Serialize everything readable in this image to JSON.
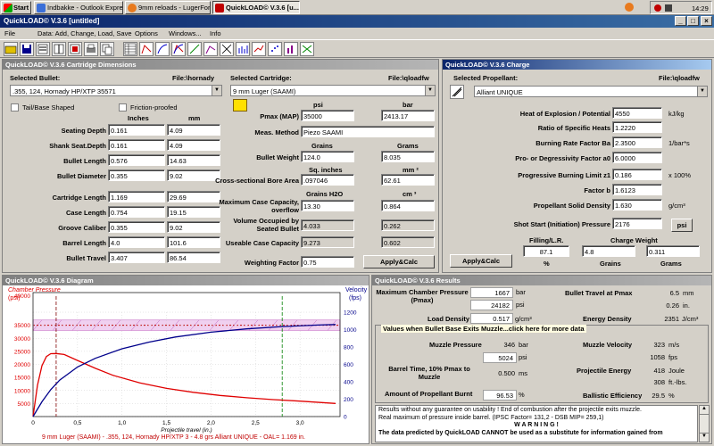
{
  "taskbar": {
    "start": "Start",
    "tasks": [
      "Indbakke - Outlook Express",
      "9mm reloads - LugerForu...",
      "QuickLOAD© V.3.6  [u..."
    ],
    "clock": "14:29"
  },
  "window": {
    "title": "QuickLOAD© V.3.6   [untitled]"
  },
  "menu": [
    "File",
    "Data: Add, Change, Load, Save",
    "Options",
    "Windows...",
    "Info"
  ],
  "cartridge_panel": {
    "title": "QuickLOAD© V.3.6 Cartridge Dimensions",
    "selected_bullet_label": "Selected Bullet:",
    "bullet_file": "File:\\hornady",
    "bullet_value": ".355, 124, Hornady HP/XTP 35571",
    "tailbase_label": "Tail/Base Shaped",
    "friction_label": "Friction-proofed",
    "unit_inches": "Inches",
    "unit_mm": "mm",
    "rows": [
      {
        "label": "Seating Depth",
        "in": "0.161",
        "mm": "4.09"
      },
      {
        "label": "Shank Seat.Depth",
        "in": "0.161",
        "mm": "4.09"
      },
      {
        "label": "Bullet Length",
        "in": "0.576",
        "mm": "14.63"
      },
      {
        "label": "Bullet Diameter",
        "in": "0.355",
        "mm": "9.02"
      },
      {
        "label": "Cartridge Length",
        "in": "1.169",
        "mm": "29.69"
      },
      {
        "label": "Case Length",
        "in": "0.754",
        "mm": "19.15"
      },
      {
        "label": "Groove Caliber",
        "in": "0.355",
        "mm": "9.02"
      },
      {
        "label": "Barrel Length",
        "in": "4.0",
        "mm": "101.6"
      },
      {
        "label": "Bullet Travel",
        "in": "3.407",
        "mm": "86.54"
      }
    ],
    "selected_cartridge_label": "Selected Cartridge:",
    "cartridge_file": "File:\\qloadfw",
    "cartridge_value": "9 mm Luger (SAAMI)",
    "psi_label": "psi",
    "bar_label": "bar",
    "pmax_label": "Pmax (MAP)",
    "pmax_psi": "35000",
    "pmax_bar": "2413.17",
    "meas_method_label": "Meas. Method",
    "meas_method": "Piezo SAAMI",
    "grains_label": "Grains",
    "grams_label": "Grams",
    "bullet_weight_label": "Bullet Weight",
    "bullet_weight_gr": "124.0",
    "bullet_weight_g": "8.035",
    "sq_inches_label": "Sq. inches",
    "mm2_label": "mm ²",
    "bore_area_label": "Cross-sectional Bore Area",
    "bore_area_in": ".097046",
    "bore_area_mm": "62.61",
    "grains_h2o_label": "Grains H2O",
    "cm3_label": "cm ³",
    "max_case_label": "Maximum Case Capacity, overflow",
    "max_case_gr": "13.30",
    "max_case_cm": "0.864",
    "vol_seated_label": "Volume Occupied by Seated Bullet",
    "vol_seated_gr": "4.033",
    "vol_seated_cm": "0.262",
    "useable_label": "Useable Case Capacity",
    "useable_gr": "9.273",
    "useable_cm": "0.602",
    "weighting_label": "Weighting Factor",
    "weighting": "0.75",
    "apply_label": "Apply&Calc"
  },
  "charge_panel": {
    "title": "QuickLOAD© V.3.6 Charge",
    "selected_propellant_label": "Selected Propellant:",
    "prop_file": "File:\\qloadfw",
    "propellant": "Alliant UNIQUE",
    "rows": [
      {
        "label": "Heat of Explosion / Potential",
        "value": "4550",
        "unit": "kJ/kg"
      },
      {
        "label": "Ratio of Specific Heats",
        "value": "1.2220",
        "unit": ""
      },
      {
        "label": "Burning Rate Factor  Ba",
        "value": "2.3500",
        "unit": "1/bar*s"
      },
      {
        "label": "Pro- or Degressivity Factor  a0",
        "value": "6.0000",
        "unit": ""
      },
      {
        "label": "Progressive Burning Limit z1",
        "value": "0.186",
        "unit": "x 100%"
      },
      {
        "label": "Factor  b",
        "value": "1.6123",
        "unit": ""
      },
      {
        "label": "Propellant Solid Density",
        "value": "1.630",
        "unit": "g/cm³"
      },
      {
        "label": "Shot Start (Initiation) Pressure",
        "value": "2176",
        "unit": ""
      }
    ],
    "psi_button": "psi",
    "filling_label": "Filling/L.R.",
    "charge_weight_label": "Charge Weight",
    "filling": "87.1",
    "charge_grains": "4.8",
    "charge_grams": "0.311",
    "pct": "%",
    "grains": "Grains",
    "grams": "Grams",
    "apply_label": "Apply&Calc"
  },
  "diagram_panel": {
    "title": "QuickLOAD© V.3.6 Diagram",
    "caption": "9 mm Luger (SAAMI) - .355, 124, Hornady HP/XTP 3 - 4.8 grs Alliant UNIQUE - OAL= 1.169 in."
  },
  "chart_data": {
    "type": "line",
    "xlabel": "Projectile travel (in.)",
    "ylabel_left": "Chamber Pressure (psi)",
    "ylabel_right": "Velocity (fps)",
    "x_ticks": [
      "0",
      "0,5",
      "1,0",
      "1,5",
      "2,0",
      "2,5",
      "3,0"
    ],
    "y_left_ticks": [
      "0",
      "5000",
      "10000",
      "15000",
      "20000",
      "25000",
      "30000",
      "35000",
      "40000"
    ],
    "y_left_labels_shown": [
      "5000",
      "10000",
      "15000",
      "20000",
      "25000",
      "30000",
      "35000"
    ],
    "y_left_overlay_label": "40000",
    "y_right_ticks": [
      "0",
      "200",
      "400",
      "600",
      "800",
      "1000",
      "1200"
    ],
    "xlim": [
      0,
      3.45
    ],
    "ylim_left": [
      0,
      40000
    ],
    "ylim_right": [
      0,
      1200
    ],
    "colors": {
      "pressure": "#e00000",
      "velocity": "#00008b",
      "band": "#c060c0",
      "pmax": "#c00000",
      "marker": "#008000"
    },
    "series": [
      {
        "name": "Chamber Pressure",
        "axis": "left",
        "x": [
          0,
          0.05,
          0.1,
          0.15,
          0.2,
          0.26,
          0.35,
          0.5,
          0.7,
          0.9,
          1.2,
          1.5,
          1.8,
          2.1,
          2.4,
          2.7,
          3.0,
          3.4
        ],
        "y": [
          0,
          12000,
          19500,
          23000,
          24100,
          24182,
          23800,
          21500,
          18500,
          15800,
          12900,
          10800,
          9300,
          8100,
          7200,
          6500,
          5900,
          5024
        ]
      },
      {
        "name": "Velocity",
        "axis": "right",
        "x": [
          0,
          0.1,
          0.2,
          0.3,
          0.5,
          0.7,
          1.0,
          1.3,
          1.6,
          2.0,
          2.4,
          2.8,
          3.2,
          3.4
        ],
        "y": [
          0,
          170,
          310,
          420,
          570,
          670,
          780,
          855,
          915,
          970,
          1008,
          1035,
          1052,
          1058
        ]
      }
    ],
    "pmax_band": [
      33000,
      37000
    ],
    "pmax_line": 35000,
    "marker_x": 0.26,
    "case_mouth_x": 2.8
  },
  "results_panel": {
    "title": "QuickLOAD© V.3.6 Results",
    "max_pressure_label": "Maximum Chamber Pressure (Pmax)",
    "max_bar": "1667",
    "max_psi": "24182",
    "unit_bar": "bar",
    "unit_psi": "psi",
    "travel_pmax_label": "Bullet Travel at Pmax",
    "travel_mm": "6.5",
    "travel_in": "0.26",
    "unit_mm": "mm",
    "unit_in": "in.",
    "load_density_label": "Load Density",
    "load_density": "0.517",
    "unit_gcm": "g/cm³",
    "energy_density_label": "Energy Density",
    "energy_density": "2351",
    "unit_jcm": "J/cm³",
    "muzzle_header": "Values when Bullet Base Exits Muzzle...click here for more data",
    "muzzle_pressure_label": "Muzzle Pressure",
    "muzzle_bar": "346",
    "muzzle_psi": "5024",
    "muzzle_velocity_label": "Muzzle Velocity",
    "mv_ms": "323",
    "mv_fps": "1058",
    "unit_ms": "m/s",
    "unit_fps": "fps",
    "barrel_time_label": "Barrel Time, 10% Pmax to Muzzle",
    "barrel_time": "0.500",
    "unit_msec": "ms",
    "proj_energy_label": "Projectile Energy",
    "energy_j": "418",
    "energy_ftlb": "308",
    "unit_joule": "Joule",
    "unit_ftlbs": "ft.-lbs.",
    "burnt_label": "Amount of Propellant Burnt",
    "burnt": "96.53",
    "unit_pct": "%",
    "ballistic_label": "Ballistic Efficiency",
    "ballistic": "29.5",
    "warn_line1": "Results without any guarantee on usability !   End of combustion after the projectile exits muzzle.",
    "warn_line2": "Real maximum of pressure inside barrel.   (IPSC Factor= 131,2 - DSB MIP= 259,1)",
    "warn_line3": "W A R N I N G !",
    "warn_line4": "The data predicted by QuickLOAD CANNOT be used as a substitute for information gained from"
  }
}
